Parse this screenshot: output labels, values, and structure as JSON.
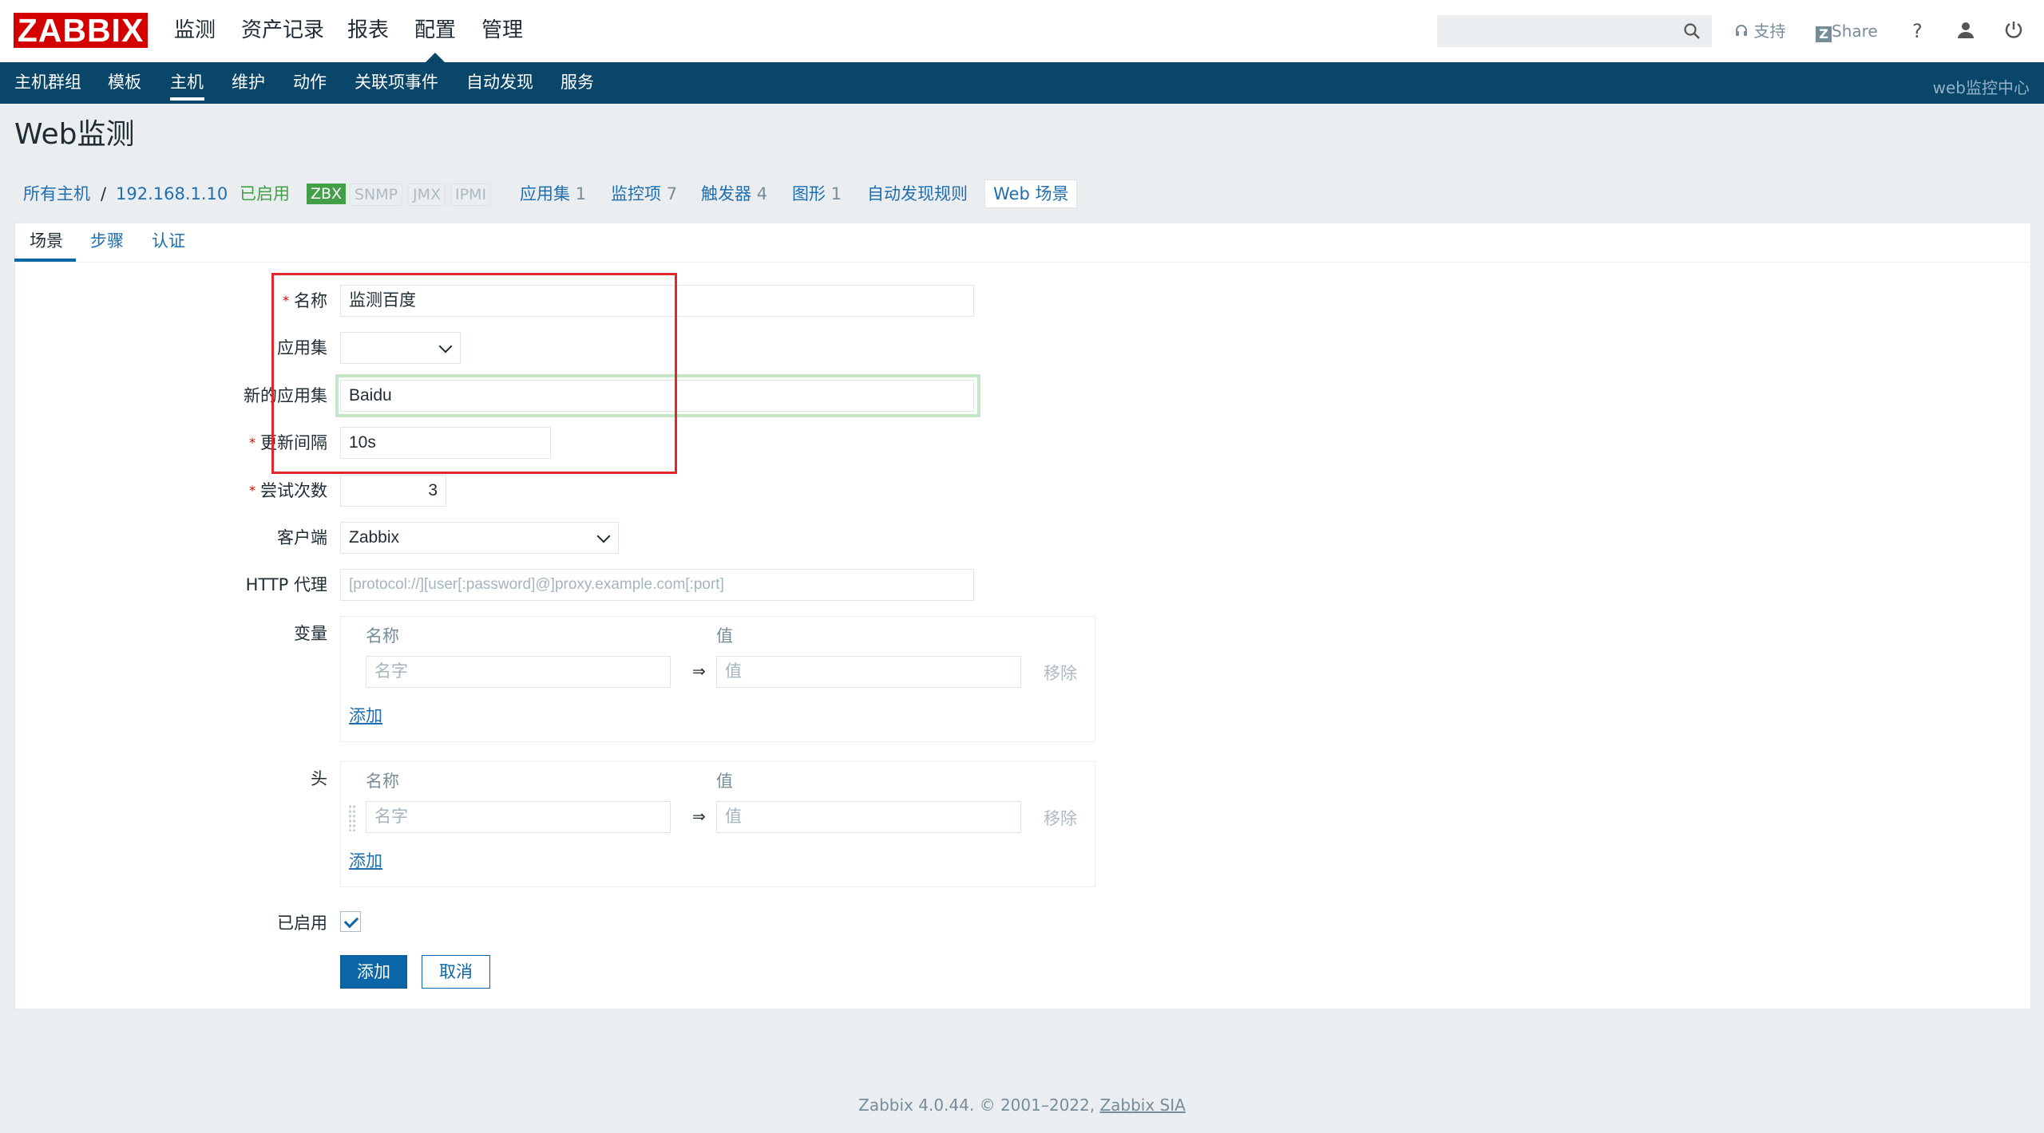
{
  "header": {
    "logo": "ZABBIX",
    "menu": [
      "监测",
      "资产记录",
      "报表",
      "配置",
      "管理"
    ],
    "support": "支持",
    "share": "Share",
    "help": "?"
  },
  "subnav": {
    "items": [
      "主机群组",
      "模板",
      "主机",
      "维护",
      "动作",
      "关联项事件",
      "自动发现",
      "服务"
    ],
    "server_name": "web监控中心"
  },
  "page_title": "Web监测",
  "host_nav": {
    "all_hosts": "所有主机",
    "separator": "/",
    "host": "192.168.1.10",
    "status": "已启用",
    "badges": [
      "ZBX",
      "SNMP",
      "JMX",
      "IPMI"
    ],
    "applications": "应用集",
    "applications_count": "1",
    "items": "监控项",
    "items_count": "7",
    "triggers": "触发器",
    "triggers_count": "4",
    "graphs": "图形",
    "graphs_count": "1",
    "discovery": "自动发现规则",
    "web": "Web 场景"
  },
  "tabs": [
    "场景",
    "步骤",
    "认证"
  ],
  "form": {
    "name_label": "名称",
    "name_value": "监测百度",
    "application_label": "应用集",
    "new_application_label": "新的应用集",
    "new_application_value": "Baidu",
    "interval_label": "更新间隔",
    "interval_value": "10s",
    "attempts_label": "尝试次数",
    "attempts_value": "3",
    "agent_label": "客户端",
    "agent_value": "Zabbix",
    "proxy_label": "HTTP 代理",
    "proxy_placeholder": "[protocol://][user[:password]@]proxy.example.com[:port]",
    "variables_label": "变量",
    "headers_label": "头",
    "col_name": "名称",
    "col_value": "值",
    "name_placeholder": "名字",
    "value_placeholder": "值",
    "arrow": "⇒",
    "remove": "移除",
    "add": "添加",
    "enabled_label": "已启用",
    "enabled_checked": true,
    "submit_button": "添加",
    "cancel_button": "取消"
  },
  "footer": {
    "text": "Zabbix 4.0.44. © 2001–2022, ",
    "link": "Zabbix SIA"
  }
}
